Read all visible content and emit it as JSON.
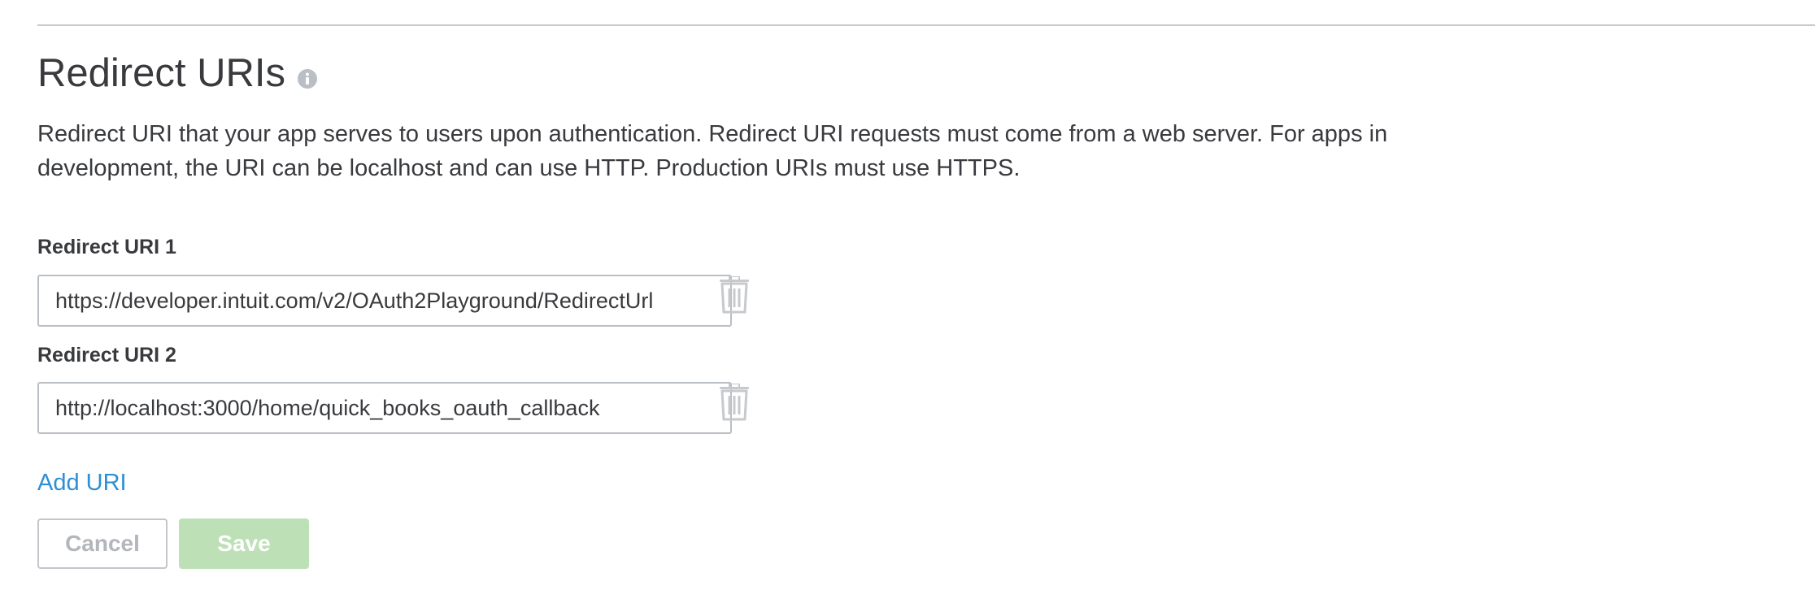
{
  "section": {
    "title": "Redirect URIs",
    "description": "Redirect URI that your app serves to users upon authentication. Redirect URI requests must come from a web server. For apps in development, the URI can be localhost and can use HTTP. Production URIs must use HTTPS."
  },
  "uris": [
    {
      "label": "Redirect URI 1",
      "value": "https://developer.intuit.com/v2/OAuth2Playground/RedirectUrl"
    },
    {
      "label": "Redirect URI 2",
      "value": "http://localhost:3000/home/quick_books_oauth_callback"
    }
  ],
  "actions": {
    "add_uri_label": "Add URI",
    "cancel_label": "Cancel",
    "save_label": "Save"
  },
  "icons": {
    "info": "info-icon",
    "delete": "trash-icon"
  },
  "colors": {
    "link": "#2d8fd5",
    "save_disabled": "#bde0b6",
    "text": "#393a3d"
  }
}
